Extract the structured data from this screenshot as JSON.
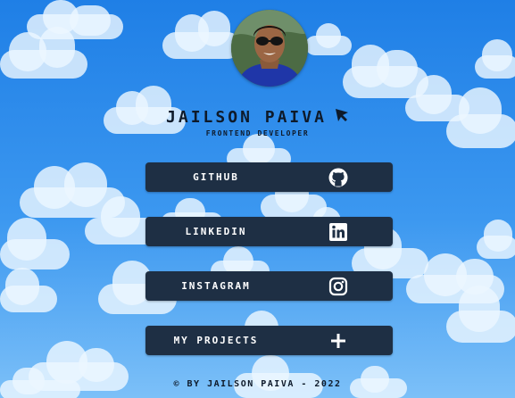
{
  "profile": {
    "name": "JAILSON PAIVA",
    "role": "FRONTEND DEVELOPER"
  },
  "links": [
    {
      "label": "GITHUB",
      "icon": "github-icon"
    },
    {
      "label": "LINKEDIN",
      "icon": "linkedin-icon"
    },
    {
      "label": "INSTAGRAM",
      "icon": "instagram-icon"
    },
    {
      "label": "MY PROJECTS",
      "icon": "plus-icon"
    }
  ],
  "footer": {
    "text": "© BY JAILSON PAIVA - 2022"
  },
  "colors": {
    "sky_top": "#1f7fe6",
    "sky_bottom": "#7cc0f8",
    "button_bg": "#1e2f44",
    "button_text": "#ffffff",
    "heading_text": "#0e1a2a"
  }
}
